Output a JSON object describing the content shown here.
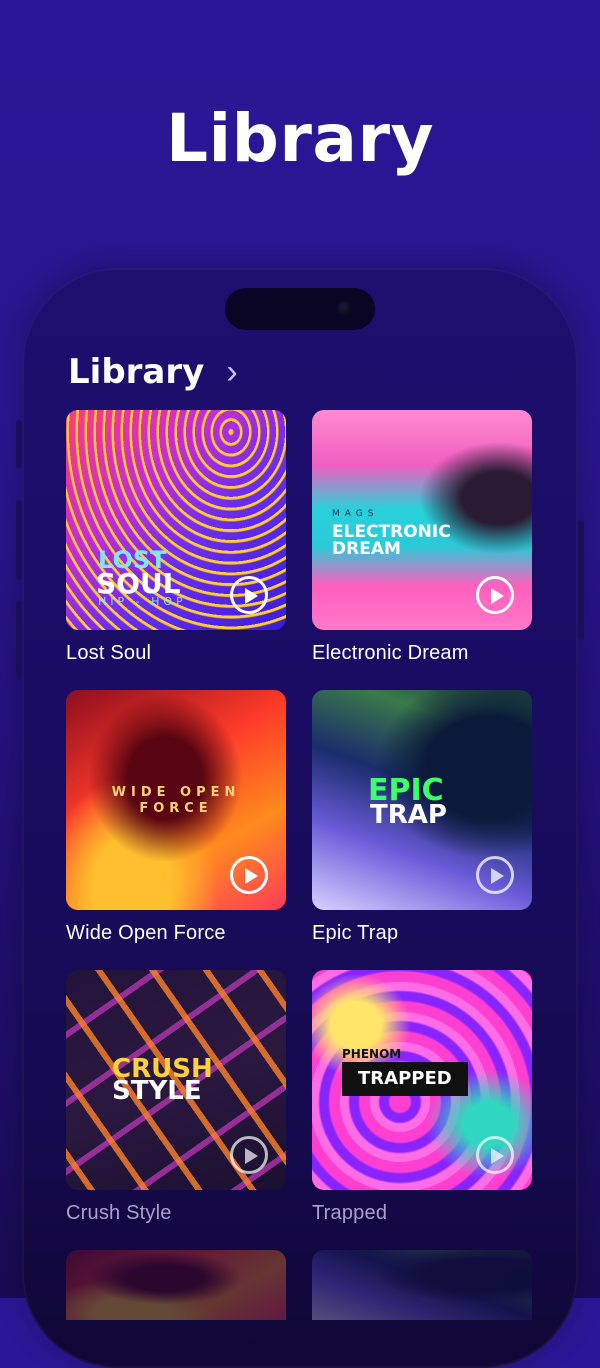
{
  "header": {
    "title": "Library"
  },
  "phone": {
    "section_title": "Library",
    "chevron": "›",
    "items": [
      {
        "title": "Lost Soul",
        "cover_lines": [
          "LOST",
          "SOUL",
          "HIP - HOP"
        ]
      },
      {
        "title": "Electronic Dream",
        "cover_lines": [
          "MAGS",
          "ELECTRONIC",
          "DREAM"
        ]
      },
      {
        "title": "Wide Open Force",
        "cover_lines": [
          "WIDE OPEN",
          "FORCE"
        ]
      },
      {
        "title": "Epic Trap",
        "cover_lines": [
          "EPIC",
          "TRAP"
        ]
      },
      {
        "title": "Crush Style",
        "cover_lines": [
          "CRUSH",
          "STYLE"
        ]
      },
      {
        "title": "Trapped",
        "cover_lines": [
          "PHENOM",
          "TRAPPED"
        ]
      }
    ]
  },
  "colors": {
    "background_top": "#2b1796",
    "background_bottom": "#180b54",
    "accent_cyan": "#5ee7ff",
    "accent_yellow": "#ffd23a",
    "accent_green": "#3dff6a"
  },
  "icons": {
    "play": "play-circle-icon",
    "chevron": "chevron-right-icon"
  }
}
